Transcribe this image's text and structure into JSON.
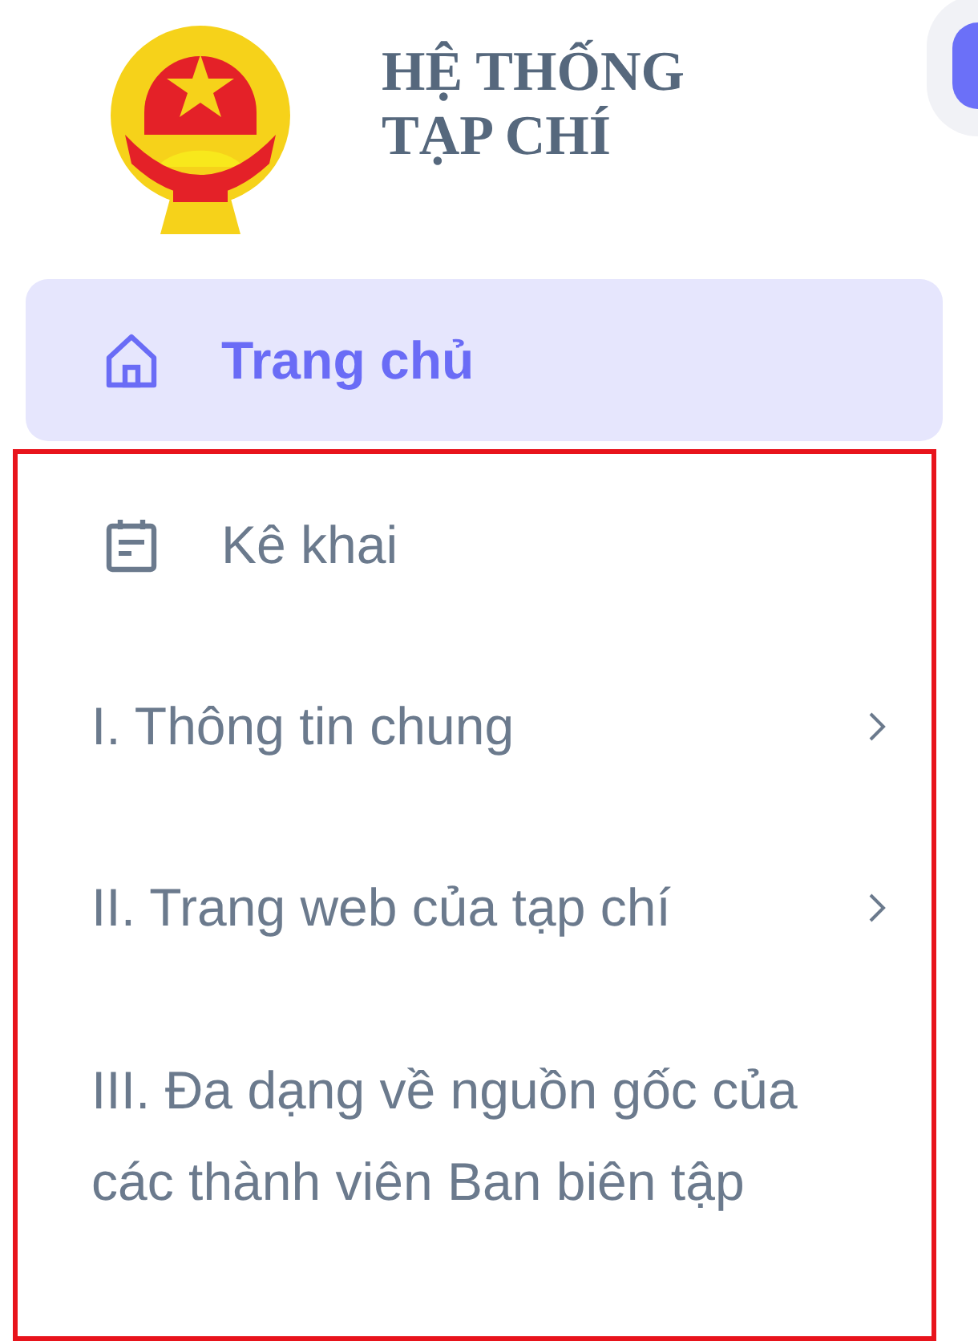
{
  "header": {
    "title_lines": [
      "HỆ THỐNG",
      "TẠP CHÍ"
    ]
  },
  "nav": {
    "items": [
      {
        "label": "Trang chủ",
        "kind": "link",
        "selected": true
      }
    ]
  },
  "highlighted_section": {
    "items": [
      {
        "label": "Kê khai",
        "kind": "group-header",
        "selected": false
      },
      {
        "label": "I. Thông tin chung",
        "kind": "submenu",
        "expanded": false,
        "selected": false
      },
      {
        "label": "II. Trang web của tạp chí",
        "kind": "submenu",
        "expanded": false,
        "selected": false
      },
      {
        "label": "III. Đa dạng về nguồn gốc của các thành viên Ban biên tập",
        "kind": "item",
        "selected": false
      }
    ]
  }
}
